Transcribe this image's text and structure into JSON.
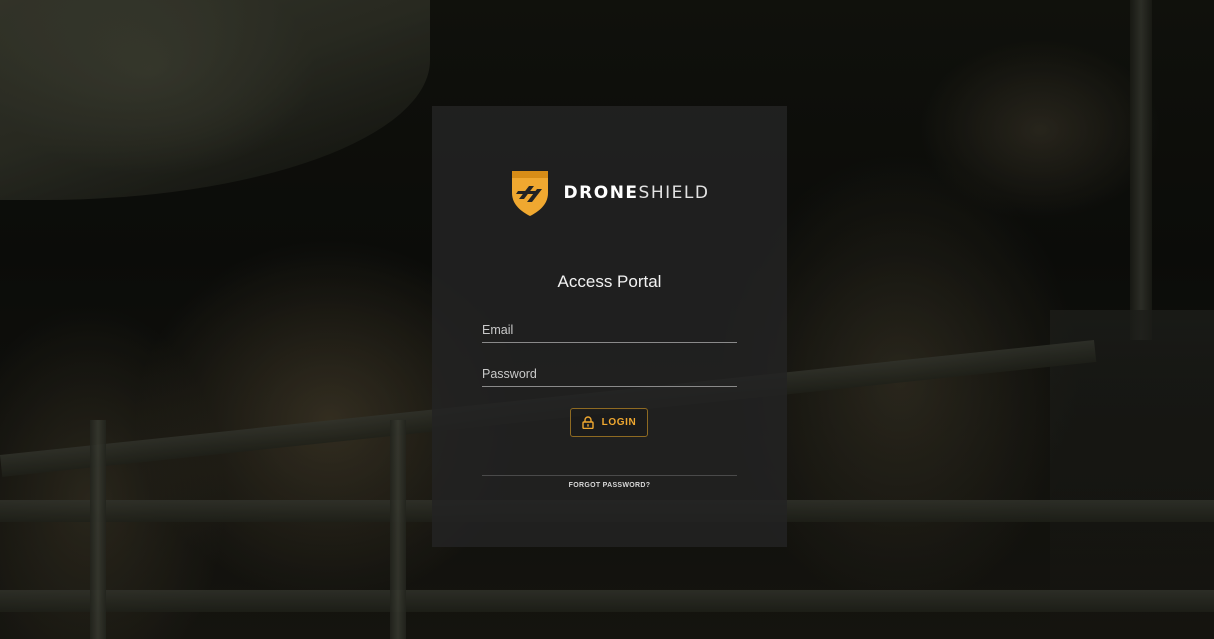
{
  "brand": {
    "name_bold": "DRONE",
    "name_light": "SHIELD",
    "logo_icon": "droneshield-shield-icon",
    "accent_color": "#f0a830"
  },
  "login_form": {
    "title": "Access Portal",
    "email_placeholder": "Email",
    "password_placeholder": "Password",
    "login_label": "LOGIN",
    "login_icon": "lock-icon",
    "forgot_label": "FORGOT PASSWORD?"
  }
}
